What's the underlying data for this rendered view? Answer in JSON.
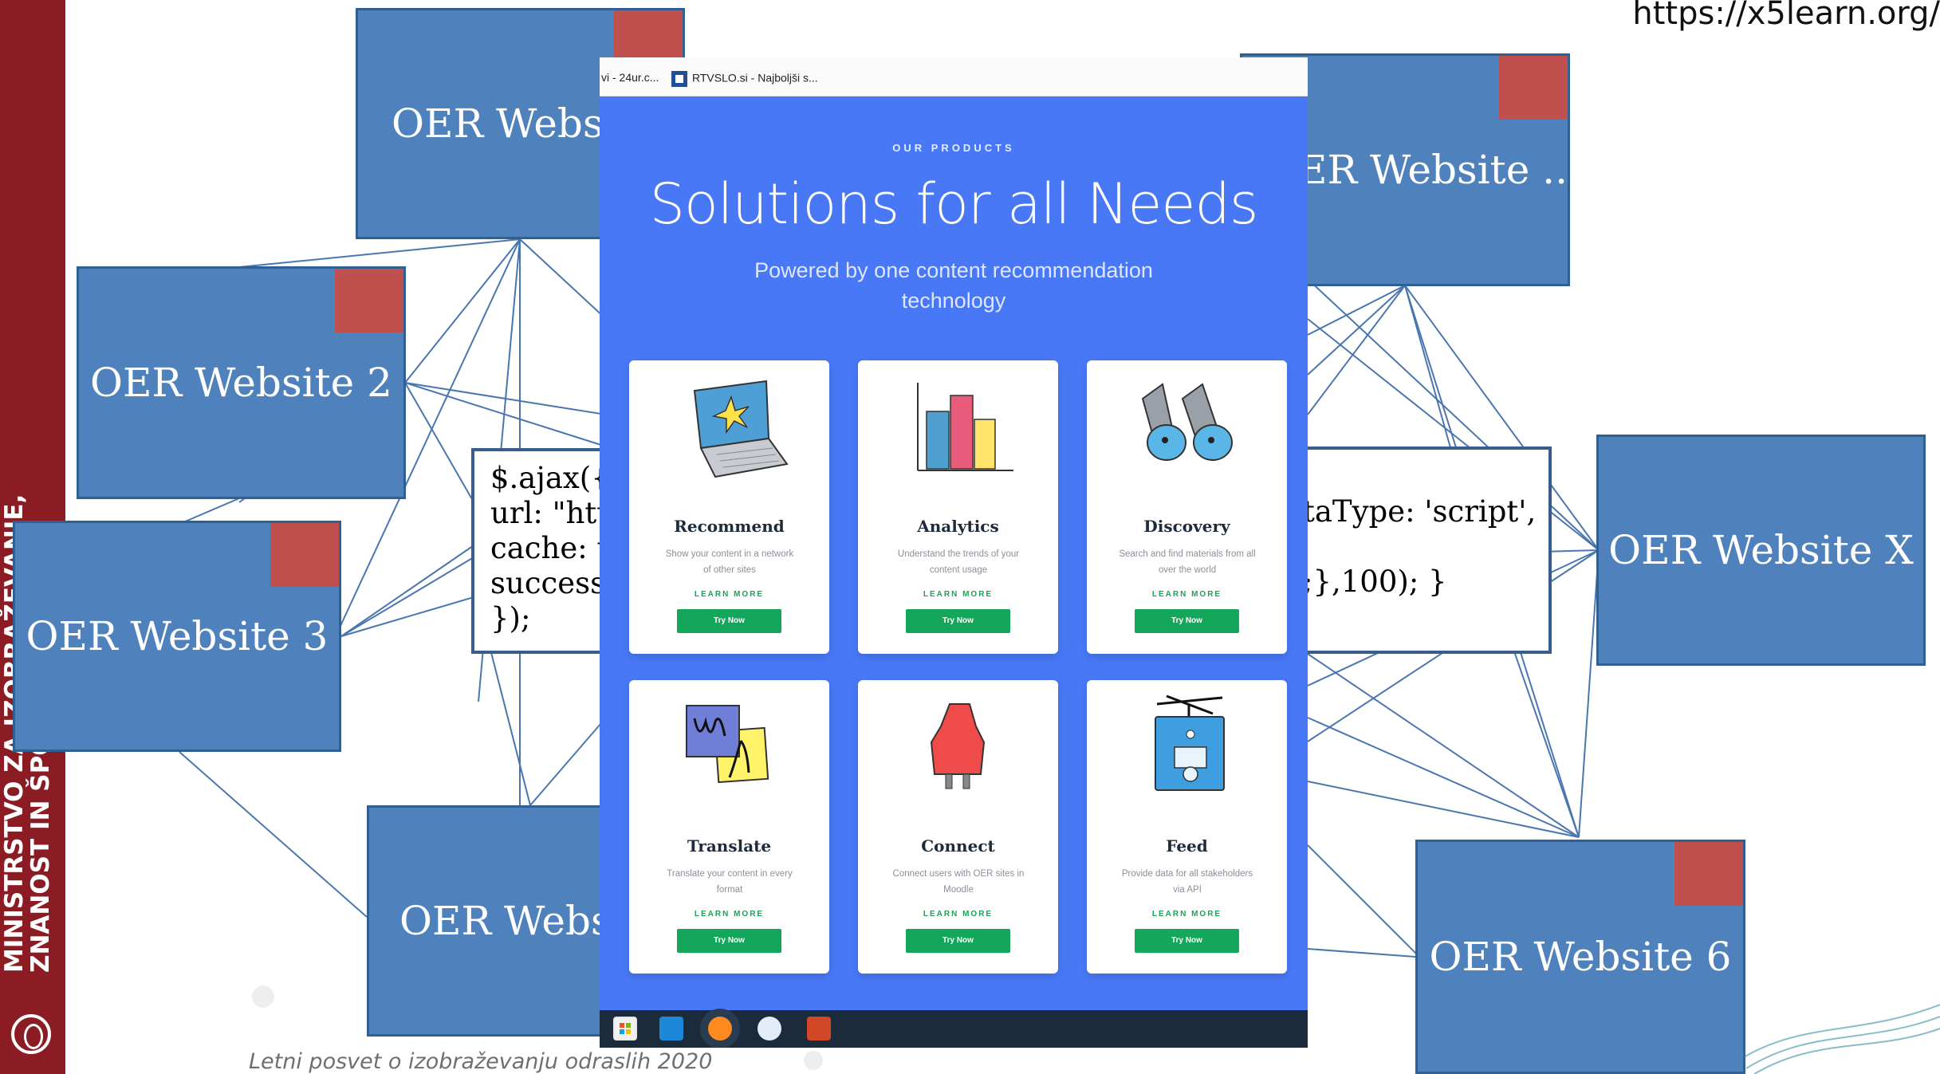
{
  "slide": {
    "url": "https://x5learn.org/",
    "footer": "Letni posvet o izobraževanju odraslih 2020",
    "ministry_line1": "MINISTRSTVO ZA IZOBRAŽEVANJE,",
    "ministry_line2": "ZNANOST IN ŠPORT"
  },
  "nodes": {
    "top": "OER Websit",
    "w2": "OER Website 2",
    "w3": "OER Website 3",
    "bottom": "OER Websit",
    "topright": "ER Website ...",
    "x": "OER Website X",
    "w6": "OER Website 6"
  },
  "code_left": [
    "$.ajax({",
    "url: \"http",
    "cache: t",
    "success:",
    "});"
  ],
  "code_right": [
    "taType: 'script',",
    ";},100); }"
  ],
  "browser": {
    "tab1": "vi - 24ur.c...",
    "tab2": "RTVSLO.si - Najboljši s..."
  },
  "page": {
    "eyebrow": "OUR PRODUCTS",
    "title": "Solutions for all Needs",
    "subtitle": "Powered by one content recommendation technology"
  },
  "products": [
    {
      "name": "Recommend",
      "desc": "Show your content in a network of other sites",
      "learn": "LEARN MORE",
      "button": "Try Now"
    },
    {
      "name": "Analytics",
      "desc": "Understand the trends of your content usage",
      "learn": "LEARN MORE",
      "button": "Try Now"
    },
    {
      "name": "Discovery",
      "desc": "Search and find materials from all over the world",
      "learn": "LEARN MORE",
      "button": "Try Now"
    },
    {
      "name": "Translate",
      "desc": "Translate your content in every format",
      "learn": "LEARN MORE",
      "button": "Try Now"
    },
    {
      "name": "Connect",
      "desc": "Connect users with OER sites in Moodle",
      "learn": "LEARN MORE",
      "button": "Try Now"
    },
    {
      "name": "Feed",
      "desc": "Provide data for all stakeholders via API",
      "learn": "LEARN MORE",
      "button": "Try Now"
    }
  ],
  "taskbar": [
    "store-icon",
    "mail-icon",
    "firefox-icon",
    "outlook-icon",
    "powerpoint-icon"
  ],
  "colors": {
    "node": "#4f81bd",
    "corner": "#c0504d",
    "page_bg": "#4878f6",
    "button": "#14a65a",
    "band": "#8b1c24"
  }
}
